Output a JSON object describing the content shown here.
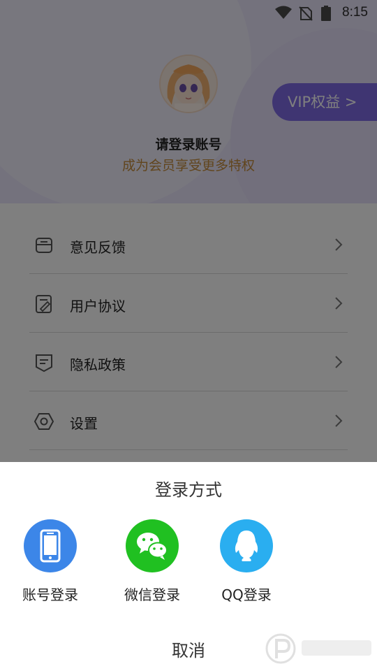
{
  "status_bar": {
    "time": "8:15",
    "icons": [
      "wifi-icon",
      "no-sim-icon",
      "battery-icon"
    ]
  },
  "profile": {
    "avatar": "anime-avatar",
    "login_prompt": "请登录账号",
    "member_promo": "成为会员享受更多特权",
    "vip_button": "VIP权益 >"
  },
  "menu": {
    "items": [
      {
        "label": "意见反馈",
        "icon": "feedback-icon"
      },
      {
        "label": "用户协议",
        "icon": "agreement-icon"
      },
      {
        "label": "隐私政策",
        "icon": "privacy-icon"
      },
      {
        "label": "设置",
        "icon": "settings-icon"
      }
    ]
  },
  "login_sheet": {
    "title": "登录方式",
    "options": [
      {
        "label": "账号登录",
        "icon": "phone-icon",
        "color": "#3c86e8"
      },
      {
        "label": "微信登录",
        "icon": "wechat-icon",
        "color": "#20c021"
      },
      {
        "label": "QQ登录",
        "icon": "qq-icon",
        "color": "#2aaef0"
      }
    ],
    "cancel": "取消"
  },
  "colors": {
    "header_bg": "#e9e5fb",
    "vip_accent": "#7f6be4",
    "promo_text": "#c28a3a"
  }
}
